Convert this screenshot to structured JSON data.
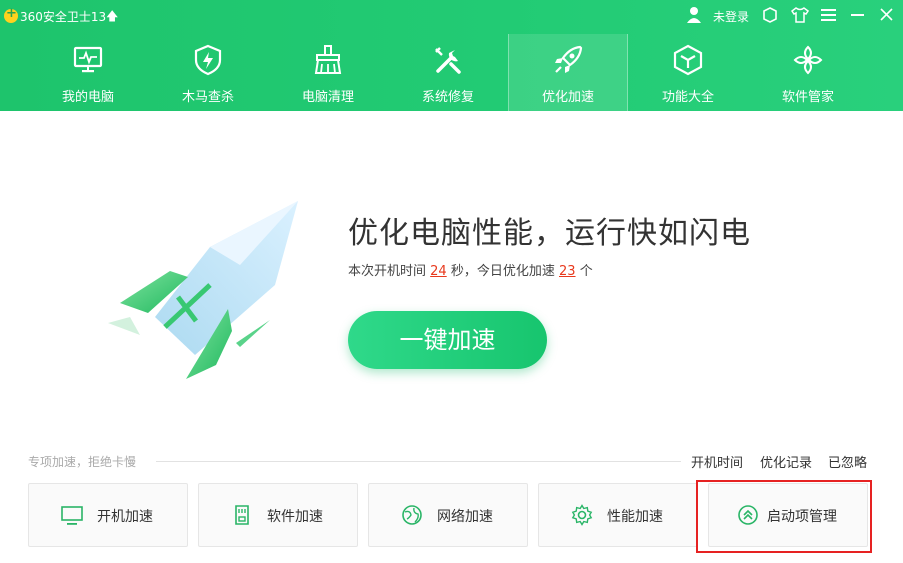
{
  "app": {
    "title": "360安全卫士13",
    "login": "未登录"
  },
  "nav": [
    {
      "label": "我的电脑",
      "icon": "monitor-icon"
    },
    {
      "label": "木马查杀",
      "icon": "shield-icon"
    },
    {
      "label": "电脑清理",
      "icon": "broom-icon"
    },
    {
      "label": "系统修复",
      "icon": "wrench-icon"
    },
    {
      "label": "优化加速",
      "icon": "rocket-icon",
      "active": true
    },
    {
      "label": "功能大全",
      "icon": "cube-icon"
    },
    {
      "label": "软件管家",
      "icon": "apps-icon"
    }
  ],
  "hero": {
    "title": "优化电脑性能，运行快如闪电",
    "sub_prefix": "本次开机时间",
    "boot_seconds": "24",
    "sub_mid": "秒，今日优化加速",
    "boost_count": "23",
    "sub_suffix": "个",
    "button": "一键加速"
  },
  "section": {
    "label": "专项加速，拒绝卡慢",
    "links": [
      "开机时间",
      "优化记录",
      "已忽略"
    ]
  },
  "cards": [
    {
      "label": "开机加速",
      "icon": "monitor-icon"
    },
    {
      "label": "软件加速",
      "icon": "sd-card-icon"
    },
    {
      "label": "网络加速",
      "icon": "globe-icon"
    },
    {
      "label": "性能加速",
      "icon": "gear-icon"
    },
    {
      "label": "启动项管理",
      "icon": "chevron-up-circle-icon"
    }
  ],
  "colors": {
    "header": "#22cb74",
    "accent": "#17c56e",
    "highlight": "#e62222",
    "number": "#e8391d"
  }
}
